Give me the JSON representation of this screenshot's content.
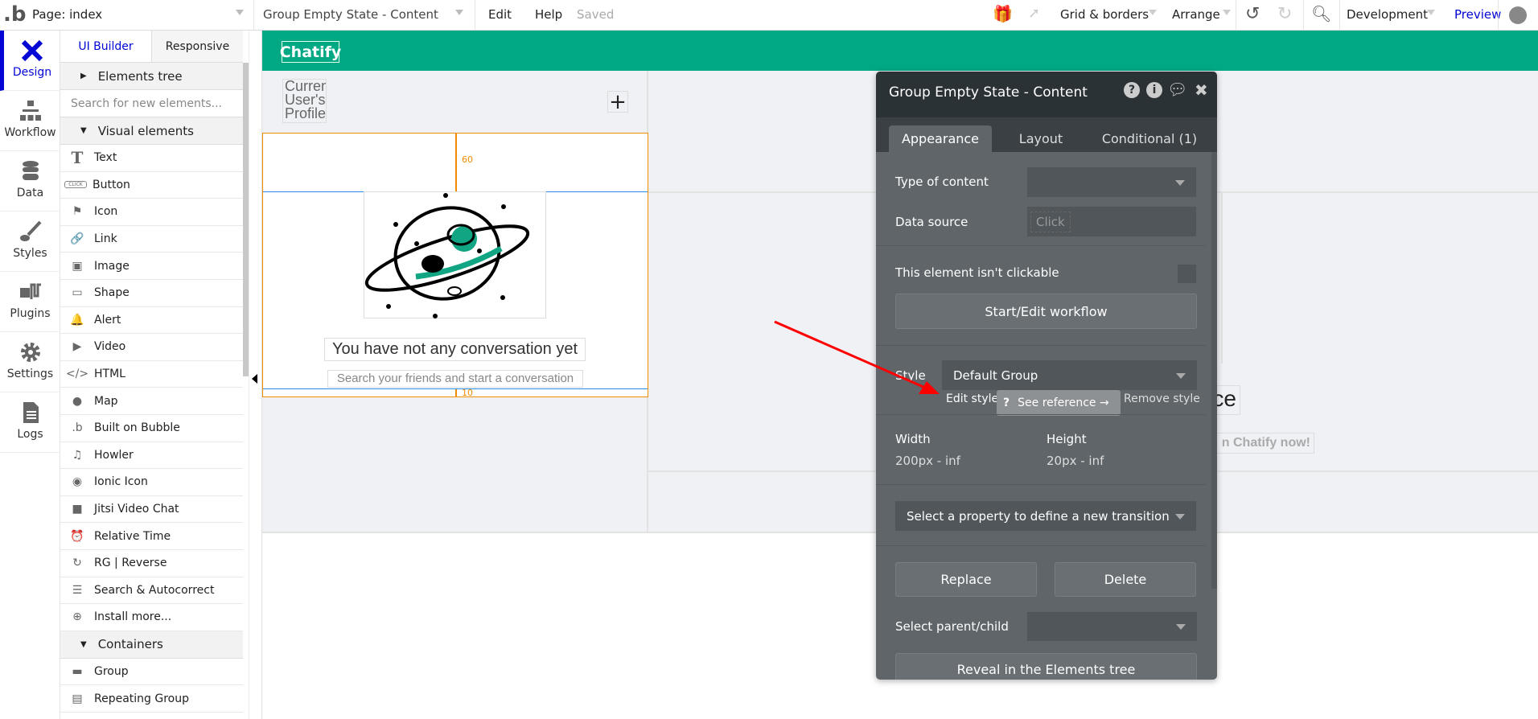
{
  "topbar": {
    "page_selector": "Page: index",
    "element_selector": "Group Empty State - Content",
    "edit": "Edit",
    "help": "Help",
    "status": "Saved",
    "grid_borders": "Grid & borders",
    "arrange": "Arrange",
    "environment": "Development",
    "preview": "Preview"
  },
  "rail": [
    {
      "label": "Design",
      "icon": "design-icon"
    },
    {
      "label": "Workflow",
      "icon": "workflow-icon"
    },
    {
      "label": "Data",
      "icon": "database-icon"
    },
    {
      "label": "Styles",
      "icon": "brush-icon"
    },
    {
      "label": "Plugins",
      "icon": "plug-icon"
    },
    {
      "label": "Settings",
      "icon": "gear-icon"
    },
    {
      "label": "Logs",
      "icon": "document-icon"
    }
  ],
  "palette": {
    "tabs": [
      "UI Builder",
      "Responsive"
    ],
    "elements_tree": "Elements tree",
    "search_placeholder": "Search for new elements...",
    "visual_elements": "Visual elements",
    "items": [
      {
        "label": "Text",
        "glyph": "T"
      },
      {
        "label": "Button",
        "glyph": "CLICK"
      },
      {
        "label": "Icon",
        "glyph": "⚑"
      },
      {
        "label": "Link",
        "glyph": "🔗"
      },
      {
        "label": "Image",
        "glyph": "▣"
      },
      {
        "label": "Shape",
        "glyph": "▭"
      },
      {
        "label": "Alert",
        "glyph": "🔔"
      },
      {
        "label": "Video",
        "glyph": "▶"
      },
      {
        "label": "HTML",
        "glyph": "</>"
      },
      {
        "label": "Map",
        "glyph": "●"
      },
      {
        "label": "Built on Bubble",
        "glyph": ".b"
      },
      {
        "label": "Howler",
        "glyph": "♫"
      },
      {
        "label": "Ionic Icon",
        "glyph": "◉"
      },
      {
        "label": "Jitsi Video Chat",
        "glyph": "■"
      },
      {
        "label": "Relative Time",
        "glyph": "⏰"
      },
      {
        "label": "RG | Reverse",
        "glyph": "↻"
      },
      {
        "label": "Search & Autocorrect",
        "glyph": "☰"
      },
      {
        "label": "Install more...",
        "glyph": "⊕"
      }
    ],
    "containers": "Containers",
    "container_items": [
      {
        "label": "Group",
        "glyph": "▬"
      },
      {
        "label": "Repeating Group",
        "glyph": "▤"
      }
    ]
  },
  "canvas": {
    "app_title": "Chatify",
    "profile_image_text": "Current User's Profile",
    "margin_top": "60",
    "margin_bottom": "10",
    "empty_title": "You have not any conversation yet",
    "empty_subtitle": "Search your friends and start a conversation",
    "partial_text_1": "ce",
    "partial_text_2": "n Chatify now!",
    "brand_color": "#00a884"
  },
  "property_panel": {
    "title": "Group Empty State - Content",
    "tabs": [
      "Appearance",
      "Layout",
      "Conditional (1)"
    ],
    "type_of_content_label": "Type of content",
    "type_of_content_value": "",
    "data_source_label": "Data source",
    "data_source_placeholder": "Click",
    "not_clickable_label": "This element isn't clickable",
    "not_clickable_checked": false,
    "workflow_button": "Start/Edit workflow",
    "style_label": "Style",
    "style_value": "Default Group",
    "edit_style": "Edit style",
    "see_reference": "See reference →",
    "remove_style": "Remove style",
    "width_label": "Width",
    "width_value": "200px - inf",
    "height_label": "Height",
    "height_value": "20px - inf",
    "transition_placeholder": "Select a property to define a new transition",
    "replace": "Replace",
    "delete": "Delete",
    "parent_child_label": "Select parent/child",
    "reveal": "Reveal in the Elements tree"
  },
  "annotation": {
    "arrow_color": "#ff0000"
  }
}
